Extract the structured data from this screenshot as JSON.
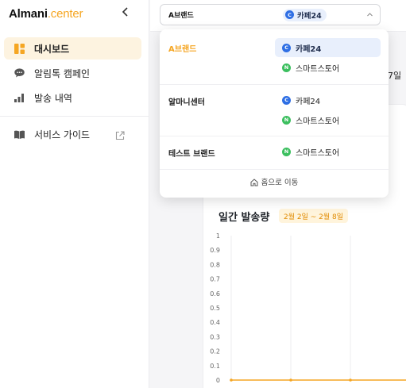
{
  "app": {
    "brand_main": "Almani",
    "brand_accent": ".center"
  },
  "colors": {
    "accent": "#f5a623",
    "cafe24": "#2f6fe4",
    "smartstore": "#3cbf5f",
    "selected_bg": "#e8effc"
  },
  "sidebar": {
    "collapse_icon": "chevron-left-icon",
    "items": [
      {
        "label": "대시보드",
        "icon": "dashboard-icon",
        "active": true
      },
      {
        "label": "알림톡 캠페인",
        "icon": "chat-bubble-icon",
        "active": false
      },
      {
        "label": "발송 내역",
        "icon": "bar-chart-icon",
        "active": false
      },
      {
        "label": "서비스 가이드",
        "icon": "book-icon",
        "active": false,
        "external_icon": "external-link-icon"
      }
    ]
  },
  "topbar": {
    "brand_selector": {
      "value": "A브랜드",
      "channel_badge": "C",
      "channel_label": "카페24",
      "caret_icon": "caret-down-icon"
    }
  },
  "dropdown": {
    "groups": [
      {
        "name": "A브랜드",
        "current": true,
        "channels": [
          {
            "badge": "C",
            "label": "카페24",
            "type": "cafe24",
            "selected": true
          },
          {
            "badge": "N",
            "label": "스마트스토어",
            "type": "smartstore",
            "selected": false
          }
        ]
      },
      {
        "name": "알마니센터",
        "current": false,
        "channels": [
          {
            "badge": "C",
            "label": "카페24",
            "type": "cafe24",
            "selected": false
          },
          {
            "badge": "N",
            "label": "스마트스토어",
            "type": "smartstore",
            "selected": false
          }
        ]
      },
      {
        "name": "테스트 브랜드",
        "current": false,
        "channels": [
          {
            "badge": "N",
            "label": "스마트스토어",
            "type": "smartstore",
            "selected": false
          }
        ]
      }
    ],
    "home_label": "홈으로 이동",
    "home_icon": "home-icon"
  },
  "main": {
    "date_fragment": "7일",
    "chart_title": "일간 발송량",
    "date_range": "2월 2일 ~ 2월 8일"
  },
  "chart_data": {
    "type": "line",
    "title": "",
    "xlabel": "",
    "ylabel": "",
    "ylim": [
      0,
      1
    ],
    "yticks": [
      "1",
      "0.9",
      "0.8",
      "0.7",
      "0.6",
      "0.5",
      "0.4",
      "0.3",
      "0.2",
      "0.1",
      "0"
    ],
    "series": [
      {
        "values": [
          0,
          0,
          0,
          0,
          0,
          0,
          0
        ]
      }
    ],
    "grid": "vertical"
  }
}
